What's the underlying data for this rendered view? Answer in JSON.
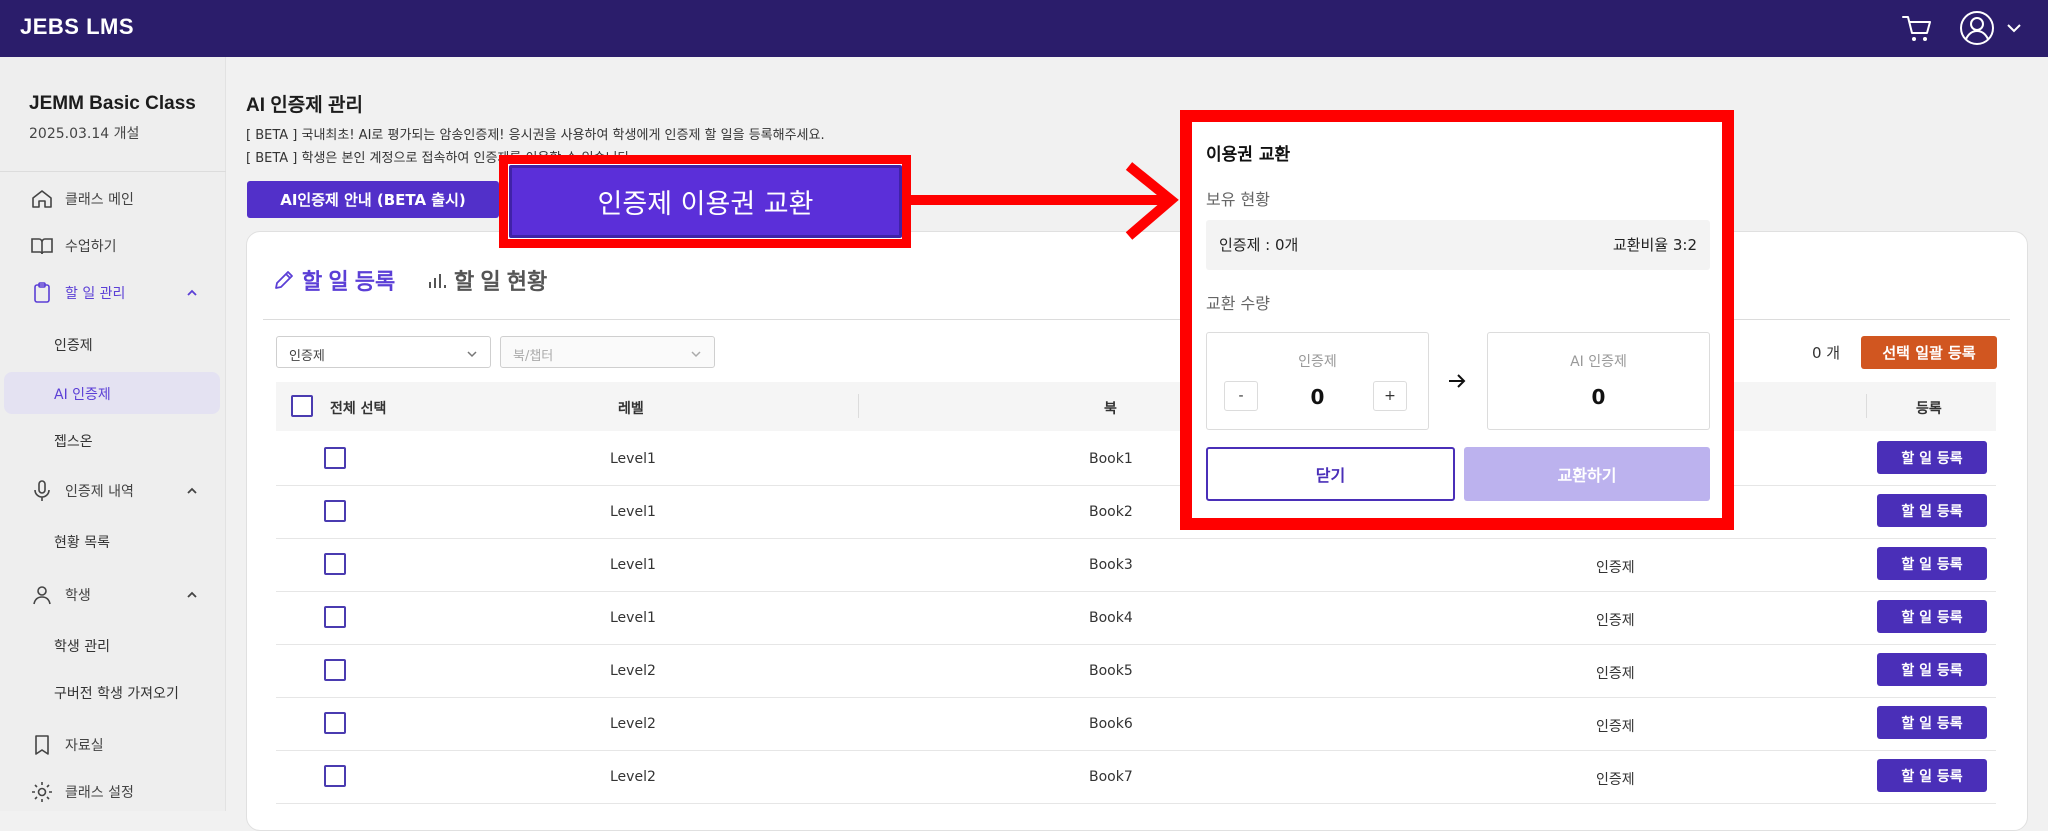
{
  "topbar": {
    "brand": "JEBS LMS",
    "icons": [
      "cart-icon",
      "user-icon",
      "chevron-down-icon"
    ]
  },
  "sidebar": {
    "class_name": "JEMM Basic Class",
    "class_date": "2025.03.14 개설",
    "items": [
      {
        "label": "클래스 메인",
        "icon": "home-icon"
      },
      {
        "label": "수업하기",
        "icon": "book-open-icon"
      },
      {
        "label": "할 일 관리",
        "icon": "clipboard-icon",
        "expanded": true
      },
      {
        "label": "인증제",
        "sub": true
      },
      {
        "label": "AI 인증제",
        "sub": true,
        "active": true
      },
      {
        "label": "젭스온",
        "sub": true
      },
      {
        "label": "인증제 내역",
        "icon": "mic-icon",
        "expanded": true
      },
      {
        "label": "현황 목록",
        "sub": true
      },
      {
        "label": "학생",
        "icon": "person-icon",
        "expanded": true
      },
      {
        "label": "학생 관리",
        "sub": true
      },
      {
        "label": "구버전 학생 가져오기",
        "sub": true
      },
      {
        "label": "자료실",
        "icon": "bookmark-icon"
      },
      {
        "label": "클래스 설정",
        "icon": "gear-icon"
      }
    ]
  },
  "main": {
    "title": "AI 인증제 관리",
    "desc1": "[ BETA ] 국내최초! AI로 평가되는 암송인증제! 응시권을 사용하여 학생에게 인증제 할 일을 등록해주세요.",
    "desc2": "[ BETA ] 학생은 본인 계정으로 접속하여 인증제를 이용할 수 있습니다.",
    "guide_button": "AI인증제 안내 (BETA 출시)",
    "tabs": {
      "register": "할 일 등록",
      "status": "할 일 현황"
    },
    "filters": {
      "type": "인증제",
      "book": "북/챕터"
    },
    "selected_count": "0 개",
    "bulk_button": "선택 일괄 등록",
    "table": {
      "headers": {
        "select_all": "전체 선택",
        "level": "레벨",
        "book": "북",
        "register": "등록"
      },
      "rows": [
        {
          "level": "Level1",
          "book": "Book1",
          "type": ""
        },
        {
          "level": "Level1",
          "book": "Book2",
          "type": ""
        },
        {
          "level": "Level1",
          "book": "Book3",
          "type": "인증제"
        },
        {
          "level": "Level1",
          "book": "Book4",
          "type": "인증제"
        },
        {
          "level": "Level2",
          "book": "Book5",
          "type": "인증제"
        },
        {
          "level": "Level2",
          "book": "Book6",
          "type": "인증제"
        },
        {
          "level": "Level2",
          "book": "Book7",
          "type": "인증제"
        }
      ],
      "row_button": "할 일 등록"
    }
  },
  "callout": {
    "button": "인증제 이용권 교환"
  },
  "modal": {
    "title": "이용권 교환",
    "holding_label": "보유 현황",
    "holding_text": "인증제 : 0개",
    "ratio_text": "교환비율 3:2",
    "amount_label": "교환 수량",
    "from_label": "인증제",
    "from_value": "0",
    "minus": "-",
    "plus": "+",
    "to_label": "AI 인증제",
    "to_value": "0",
    "close_button": "닫기",
    "exchange_button": "교환하기"
  },
  "colors": {
    "topbar": "#2b1d6b",
    "primary": "#4a2fb8",
    "accent_orange": "#d15620",
    "annotation_red": "#ff0000"
  }
}
